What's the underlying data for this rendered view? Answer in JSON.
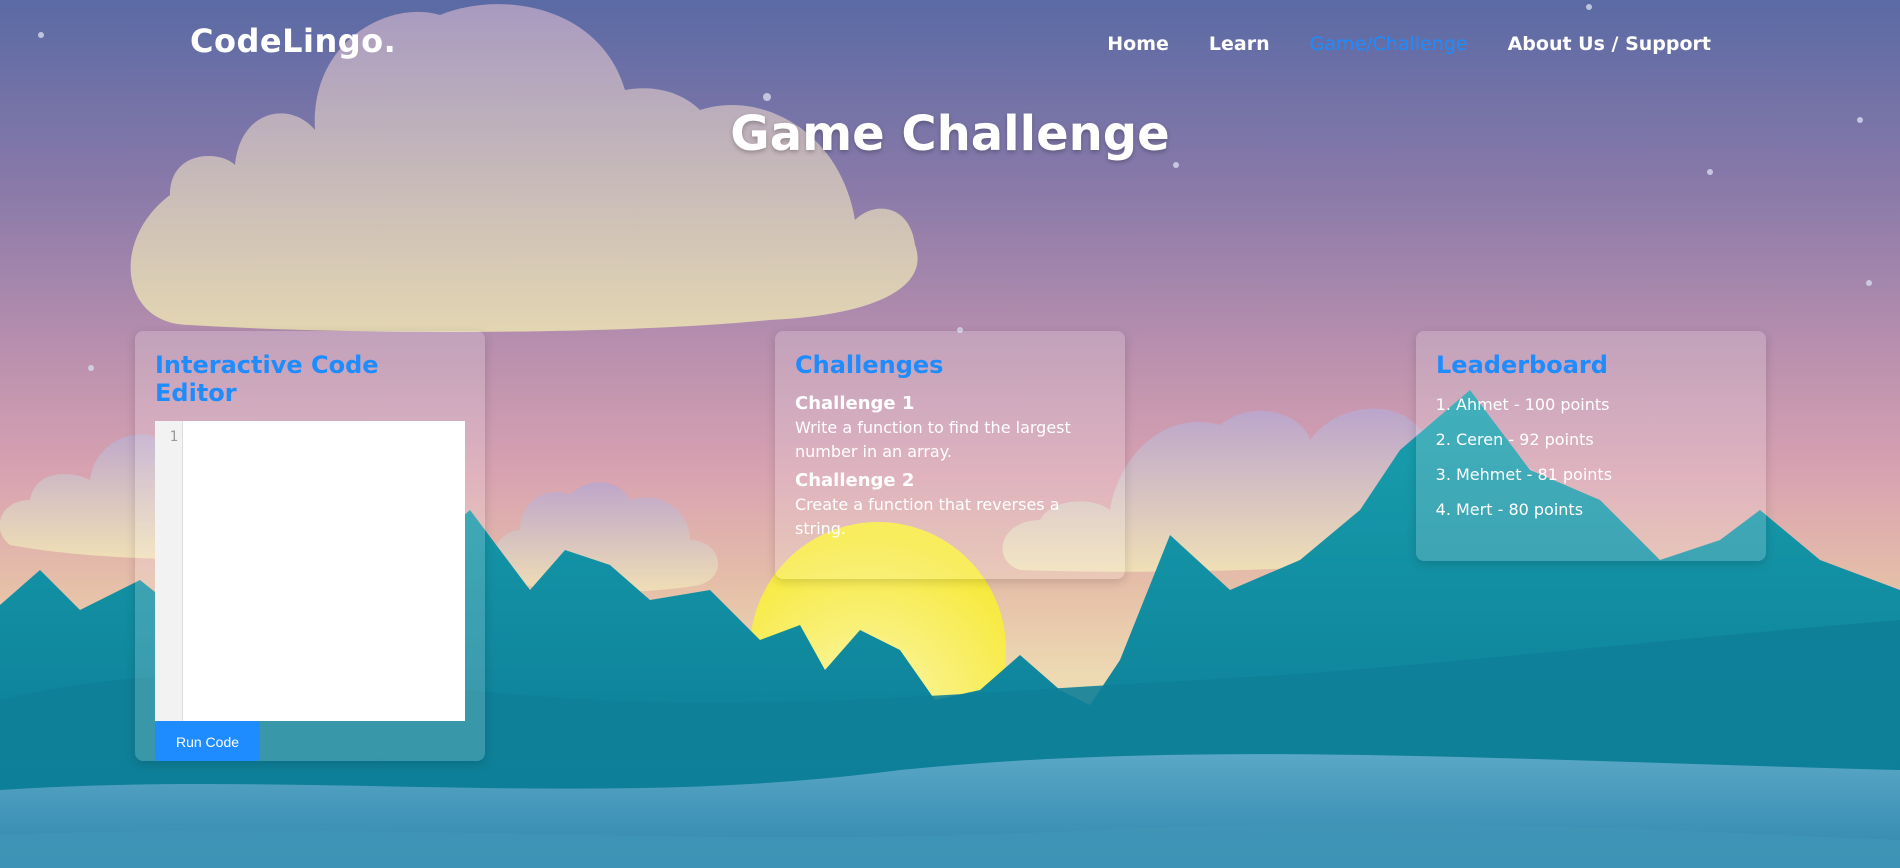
{
  "brand": {
    "logo": "CodeLingo."
  },
  "nav": {
    "items": [
      {
        "label": "Home",
        "active": false
      },
      {
        "label": "Learn",
        "active": false
      },
      {
        "label": "Game/Challenge",
        "active": true
      },
      {
        "label": "About Us / Support",
        "active": false
      }
    ]
  },
  "page": {
    "title": "Game Challenge"
  },
  "editor": {
    "heading": "Interactive Code Editor",
    "line_number": "1",
    "code": "",
    "run_label": "Run Code"
  },
  "challenges": {
    "heading": "Challenges",
    "items": [
      {
        "title": "Challenge 1",
        "desc": "Write a function to find the largest number in an array."
      },
      {
        "title": "Challenge 2",
        "desc": "Create a function that reverses a string."
      }
    ]
  },
  "leaderboard": {
    "heading": "Leaderboard",
    "entries": [
      "Ahmet - 100 points",
      "Ceren - 92 points",
      "Mehmet - 81 points",
      "Mert - 80 points"
    ]
  },
  "colors": {
    "accent": "#1e8cff",
    "sun": "#f7e93a",
    "mountain": "#14889e",
    "sea": "#4a9fbd"
  }
}
